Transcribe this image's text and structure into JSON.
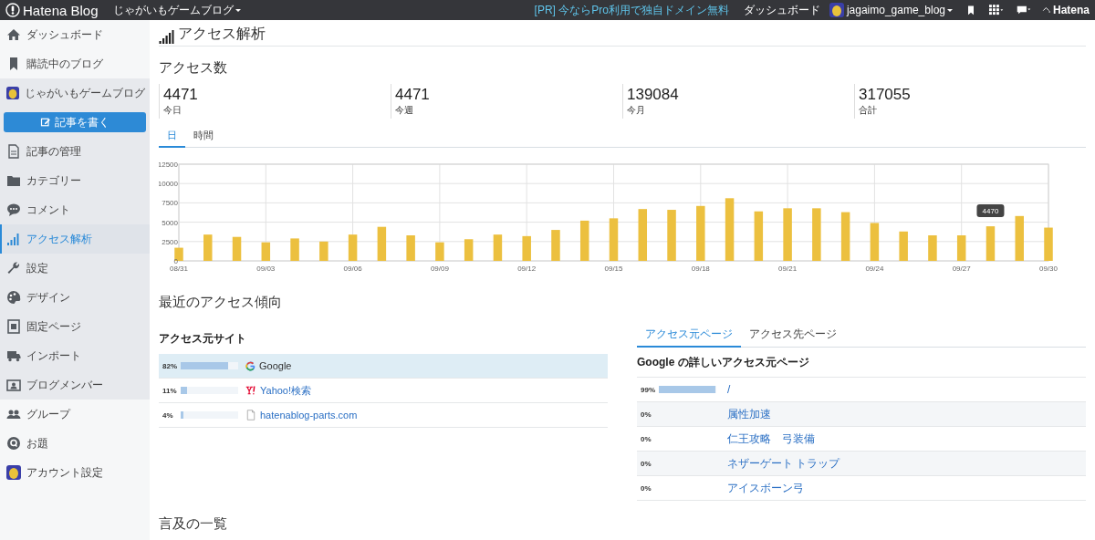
{
  "topbar": {
    "logo": "Hatena Blog",
    "blog_menu": "じゃがいもゲームブログ",
    "promo": "[PR] 今ならPro利用で独自ドメイン無料",
    "dashboard": "ダッシュボード",
    "user": "jagaimo_game_blog",
    "brand": "Hatena"
  },
  "sidebar": {
    "items": [
      {
        "kind": "link",
        "label": "ダッシュボード",
        "grouped": false,
        "selected": false
      },
      {
        "kind": "link",
        "label": "購読中のブログ",
        "grouped": false,
        "selected": false
      },
      {
        "kind": "link",
        "label": "じゃがいもゲームブログ",
        "grouped": true,
        "selected": false
      },
      {
        "kind": "button",
        "label": "記事を書く",
        "grouped": true
      },
      {
        "kind": "link",
        "label": "記事の管理",
        "grouped": true,
        "selected": false
      },
      {
        "kind": "link",
        "label": "カテゴリー",
        "grouped": true,
        "selected": false
      },
      {
        "kind": "link",
        "label": "コメント",
        "grouped": true,
        "selected": false
      },
      {
        "kind": "link",
        "label": "アクセス解析",
        "grouped": true,
        "selected": true
      },
      {
        "kind": "link",
        "label": "設定",
        "grouped": true,
        "selected": false
      },
      {
        "kind": "link",
        "label": "デザイン",
        "grouped": true,
        "selected": false
      },
      {
        "kind": "link",
        "label": "固定ページ",
        "grouped": true,
        "selected": false
      },
      {
        "kind": "link",
        "label": "インポート",
        "grouped": true,
        "selected": false
      },
      {
        "kind": "link",
        "label": "ブログメンバー",
        "grouped": true,
        "selected": false
      },
      {
        "kind": "link",
        "label": "グループ",
        "grouped": false,
        "selected": false
      },
      {
        "kind": "link",
        "label": "お題",
        "grouped": false,
        "selected": false
      },
      {
        "kind": "link",
        "label": "アカウント設定",
        "grouped": false,
        "selected": false
      }
    ]
  },
  "page_title": "アクセス解析",
  "access": {
    "title": "アクセス数",
    "stats": [
      {
        "value": "4471",
        "label": "今日"
      },
      {
        "value": "4471",
        "label": "今週"
      },
      {
        "value": "139084",
        "label": "今月"
      },
      {
        "value": "317055",
        "label": "合計"
      }
    ],
    "tabs": [
      {
        "label": "日",
        "selected": true
      },
      {
        "label": "時間",
        "selected": false
      }
    ],
    "chart_data": {
      "type": "bar",
      "grid": true,
      "categories": [
        "08/31",
        null,
        null,
        "09/03",
        null,
        null,
        "09/06",
        null,
        null,
        "09/09",
        null,
        null,
        "09/12",
        null,
        null,
        "09/15",
        null,
        null,
        "09/18",
        null,
        null,
        "09/21",
        null,
        null,
        "09/24",
        null,
        null,
        "09/27",
        null,
        null,
        "09/30"
      ],
      "series": [
        {
          "color": "#ecc03f",
          "values": [
            1700,
            3400,
            3100,
            2400,
            2900,
            2500,
            3400,
            4400,
            3300,
            2400,
            2800,
            3400,
            3200,
            4000,
            5200,
            5500,
            6700,
            6600,
            7100,
            8100,
            6400,
            6800,
            6800,
            6300,
            4900,
            3800,
            3300,
            3300,
            4470,
            5800,
            4300
          ]
        }
      ],
      "ylim": [
        0,
        12500
      ],
      "yticks": [
        0,
        2500,
        5000,
        7500,
        10000,
        12500
      ],
      "annotations": [
        {
          "y": 4470,
          "text": "4470"
        }
      ]
    }
  },
  "trends": {
    "title": "最近のアクセス傾向",
    "sources": {
      "title": "アクセス元サイト",
      "rows": [
        {
          "percent": "82%",
          "level": 0.82,
          "kind": "google",
          "name": "Google",
          "selected": true
        },
        {
          "percent": "11%",
          "level": 0.11,
          "kind": "yahoo",
          "name": "Yahoo!検索",
          "selected": false
        },
        {
          "percent": "4%",
          "level": 0.04,
          "kind": "page",
          "name": "hatenablog-parts.com",
          "selected": false
        }
      ]
    },
    "pages": {
      "tabs": [
        {
          "label": "アクセス元ページ",
          "selected": true
        },
        {
          "label": "アクセス先ページ",
          "selected": false
        }
      ],
      "title": "Google の詳しいアクセス元ページ",
      "rows": [
        {
          "percent": "99%",
          "level": 0.99,
          "name": "/"
        },
        {
          "percent": "0%",
          "name": "属性加速"
        },
        {
          "percent": "0%",
          "name": "仁王攻略　弓装備"
        },
        {
          "percent": "0%",
          "name": "ネザーゲート トラップ"
        },
        {
          "percent": "0%",
          "name": "アイスボーン弓"
        }
      ]
    }
  },
  "mentions": {
    "title": "言及の一覧"
  }
}
